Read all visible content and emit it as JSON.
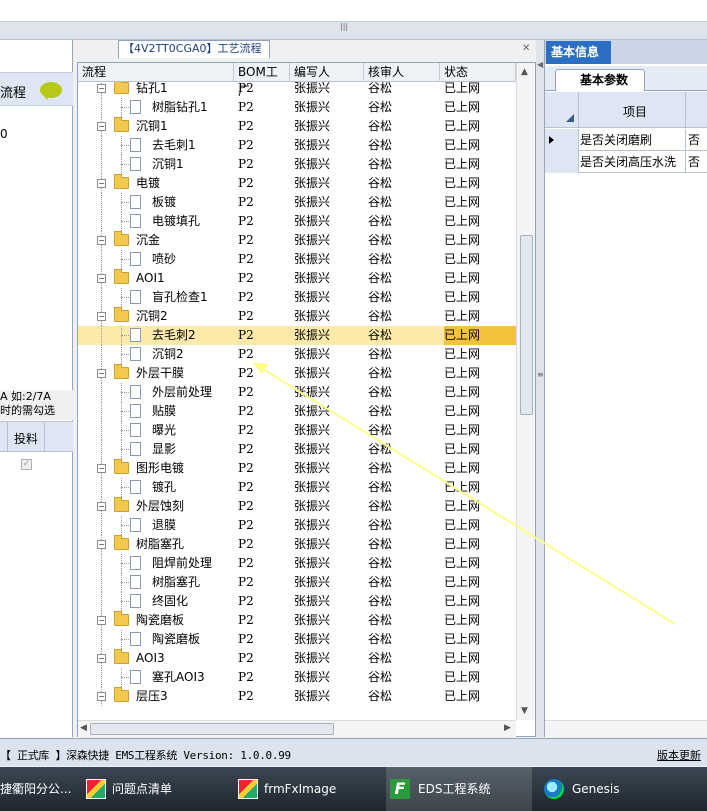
{
  "center_title": "【4V2TT0CGA0】工艺流程",
  "columns": [
    "流程",
    "BOM工厂",
    "编写人",
    "核审人",
    "状态"
  ],
  "rows": [
    {
      "name": "钻孔1",
      "type": "folder",
      "level": 1,
      "bom": "P2",
      "writer": "张振兴",
      "reviewer": "谷松",
      "status": "已上网"
    },
    {
      "name": "树脂钻孔1",
      "type": "doc",
      "level": 2,
      "bom": "P2",
      "writer": "张振兴",
      "reviewer": "谷松",
      "status": "已上网"
    },
    {
      "name": "沉铜1",
      "type": "folder",
      "level": 1,
      "bom": "P2",
      "writer": "张振兴",
      "reviewer": "谷松",
      "status": "已上网"
    },
    {
      "name": "去毛刺1",
      "type": "doc",
      "level": 2,
      "bom": "P2",
      "writer": "张振兴",
      "reviewer": "谷松",
      "status": "已上网"
    },
    {
      "name": "沉铜1",
      "type": "doc",
      "level": 2,
      "bom": "P2",
      "writer": "张振兴",
      "reviewer": "谷松",
      "status": "已上网"
    },
    {
      "name": "电镀",
      "type": "folder",
      "level": 1,
      "bom": "P2",
      "writer": "张振兴",
      "reviewer": "谷松",
      "status": "已上网"
    },
    {
      "name": "板镀",
      "type": "doc",
      "level": 2,
      "bom": "P2",
      "writer": "张振兴",
      "reviewer": "谷松",
      "status": "已上网"
    },
    {
      "name": "电镀填孔",
      "type": "doc",
      "level": 2,
      "bom": "P2",
      "writer": "张振兴",
      "reviewer": "谷松",
      "status": "已上网"
    },
    {
      "name": "沉金",
      "type": "folder",
      "level": 1,
      "bom": "P2",
      "writer": "张振兴",
      "reviewer": "谷松",
      "status": "已上网"
    },
    {
      "name": "喷砂",
      "type": "doc",
      "level": 2,
      "bom": "P2",
      "writer": "张振兴",
      "reviewer": "谷松",
      "status": "已上网"
    },
    {
      "name": "AOI1",
      "type": "folder",
      "level": 1,
      "bom": "P2",
      "writer": "张振兴",
      "reviewer": "谷松",
      "status": "已上网"
    },
    {
      "name": "盲孔检查1",
      "type": "doc",
      "level": 2,
      "bom": "P2",
      "writer": "张振兴",
      "reviewer": "谷松",
      "status": "已上网"
    },
    {
      "name": "沉铜2",
      "type": "folder",
      "level": 1,
      "bom": "P2",
      "writer": "张振兴",
      "reviewer": "谷松",
      "status": "已上网"
    },
    {
      "name": "去毛刺2",
      "type": "doc",
      "level": 2,
      "bom": "P2",
      "writer": "张振兴",
      "reviewer": "谷松",
      "status": "已上网",
      "selected": true
    },
    {
      "name": "沉铜2",
      "type": "doc",
      "level": 2,
      "bom": "P2",
      "writer": "张振兴",
      "reviewer": "谷松",
      "status": "已上网"
    },
    {
      "name": "外层干膜",
      "type": "folder",
      "level": 1,
      "bom": "P2",
      "writer": "张振兴",
      "reviewer": "谷松",
      "status": "已上网"
    },
    {
      "name": "外层前处理",
      "type": "doc",
      "level": 2,
      "bom": "P2",
      "writer": "张振兴",
      "reviewer": "谷松",
      "status": "已上网"
    },
    {
      "name": "贴膜",
      "type": "doc",
      "level": 2,
      "bom": "P2",
      "writer": "张振兴",
      "reviewer": "谷松",
      "status": "已上网"
    },
    {
      "name": "曝光",
      "type": "doc",
      "level": 2,
      "bom": "P2",
      "writer": "张振兴",
      "reviewer": "谷松",
      "status": "已上网"
    },
    {
      "name": "显影",
      "type": "doc",
      "level": 2,
      "bom": "P2",
      "writer": "张振兴",
      "reviewer": "谷松",
      "status": "已上网"
    },
    {
      "name": "图形电镀",
      "type": "folder",
      "level": 1,
      "bom": "P2",
      "writer": "张振兴",
      "reviewer": "谷松",
      "status": "已上网"
    },
    {
      "name": "镀孔",
      "type": "doc",
      "level": 2,
      "bom": "P2",
      "writer": "张振兴",
      "reviewer": "谷松",
      "status": "已上网"
    },
    {
      "name": "外层蚀刻",
      "type": "folder",
      "level": 1,
      "bom": "P2",
      "writer": "张振兴",
      "reviewer": "谷松",
      "status": "已上网"
    },
    {
      "name": "退膜",
      "type": "doc",
      "level": 2,
      "bom": "P2",
      "writer": "张振兴",
      "reviewer": "谷松",
      "status": "已上网"
    },
    {
      "name": "树脂塞孔",
      "type": "folder",
      "level": 1,
      "bom": "P2",
      "writer": "张振兴",
      "reviewer": "谷松",
      "status": "已上网"
    },
    {
      "name": "阻焊前处理",
      "type": "doc",
      "level": 2,
      "bom": "P2",
      "writer": "张振兴",
      "reviewer": "谷松",
      "status": "已上网"
    },
    {
      "name": "树脂塞孔",
      "type": "doc",
      "level": 2,
      "bom": "P2",
      "writer": "张振兴",
      "reviewer": "谷松",
      "status": "已上网"
    },
    {
      "name": "终固化",
      "type": "doc",
      "level": 2,
      "bom": "P2",
      "writer": "张振兴",
      "reviewer": "谷松",
      "status": "已上网"
    },
    {
      "name": "陶瓷磨板",
      "type": "folder",
      "level": 1,
      "bom": "P2",
      "writer": "张振兴",
      "reviewer": "谷松",
      "status": "已上网"
    },
    {
      "name": "陶瓷磨板",
      "type": "doc",
      "level": 2,
      "bom": "P2",
      "writer": "张振兴",
      "reviewer": "谷松",
      "status": "已上网"
    },
    {
      "name": "AOI3",
      "type": "folder",
      "level": 1,
      "bom": "P2",
      "writer": "张振兴",
      "reviewer": "谷松",
      "status": "已上网"
    },
    {
      "name": "塞孔AOI3",
      "type": "doc",
      "level": 2,
      "bom": "P2",
      "writer": "张振兴",
      "reviewer": "谷松",
      "status": "已上网"
    },
    {
      "name": "层压3",
      "type": "folder",
      "level": 1,
      "bom": "P2",
      "writer": "张振兴",
      "reviewer": "谷松",
      "status": "已上网"
    }
  ],
  "left_panel": {
    "header": "流程",
    "value": "0",
    "note_line1": "A 如:2/7A",
    "note_line2": "时的需勾选",
    "grid_header": "投料"
  },
  "right_panel": {
    "title": "基本信息",
    "subtab": "基本参数",
    "col_header": "项目",
    "rows": [
      {
        "key": "是否关闭磨刷",
        "value": "否"
      },
      {
        "key": "是否关闭高压水洗",
        "value": "否"
      }
    ]
  },
  "status_bar": {
    "text": "【 正式库 】深森快捷 EMS工程系统 Version: 1.0.0.99",
    "version_link": "版本更新"
  },
  "taskbar": [
    {
      "label": "捷衢阳分公...",
      "icon": "none"
    },
    {
      "label": "问题点清单",
      "icon": "app-icon"
    },
    {
      "label": "frmFxImage",
      "icon": "app-icon"
    },
    {
      "label": "EDS工程系统",
      "icon": "eds-icon",
      "active": true
    },
    {
      "label": "Genesis",
      "icon": "genesis-icon"
    }
  ],
  "colors": {
    "accent": "#2b6fc5",
    "selection": "#fde9a8",
    "folder": "#f2c94c",
    "annotation": "#ffff88"
  }
}
